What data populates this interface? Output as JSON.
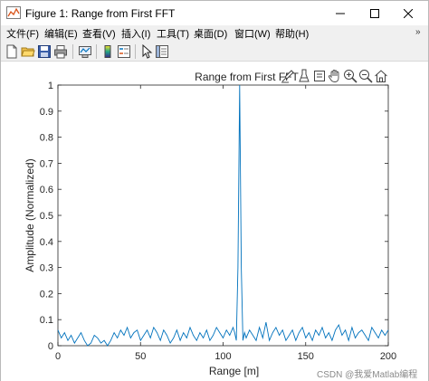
{
  "window": {
    "title": "Figure 1: Range from First FFT",
    "controls": {
      "minimize": "—",
      "maximize": "☐",
      "close": "✕"
    }
  },
  "menu": {
    "items": [
      "文件(F)",
      "编辑(E)",
      "查看(V)",
      "插入(I)",
      "工具(T)",
      "桌面(D)",
      "窗口(W)",
      "帮助(H)"
    ],
    "overflow": "»"
  },
  "toolbar": {
    "buttons": [
      "new-figure-icon",
      "open-icon",
      "save-icon",
      "print-icon",
      "link-plot-icon",
      "colorbar-icon",
      "legend-icon",
      "edit-plot-arrow-icon",
      "property-inspector-icon"
    ]
  },
  "axes_toolbar": {
    "buttons": [
      "brush-icon",
      "data-tips-icon",
      "rotate-icon",
      "pan-hand-icon",
      "zoom-in-icon",
      "zoom-out-icon",
      "home-icon"
    ]
  },
  "watermark": "CSDN @我爱Matlab编程",
  "colors": {
    "line": "#0072bd",
    "axes": "#262626",
    "figure_bg": "#ffffff",
    "window_bg": "#f0f0f0"
  },
  "chart_data": {
    "type": "line",
    "title": "Range from First FFT",
    "xlabel": "Range [m]",
    "ylabel": "Amplitude (Normalized)",
    "xlim": [
      0,
      200
    ],
    "ylim": [
      0,
      1
    ],
    "xticks": [
      0,
      50,
      100,
      150,
      200
    ],
    "yticks": [
      0,
      0.1,
      0.2,
      0.3,
      0.4,
      0.5,
      0.6,
      0.7,
      0.8,
      0.9,
      1
    ],
    "ytick_labels": [
      "0",
      "0.1",
      "0.2",
      "0.3",
      "0.4",
      "0.5",
      "0.6",
      "0.7",
      "0.8",
      "0.9",
      "1"
    ],
    "grid": false,
    "series": [
      {
        "x": [
          0,
          2,
          4,
          6,
          8,
          10,
          12,
          14,
          16,
          18,
          20,
          22,
          24,
          26,
          28,
          30,
          32,
          34,
          36,
          38,
          40,
          42,
          44,
          46,
          48,
          50,
          52,
          54,
          56,
          58,
          60,
          62,
          64,
          66,
          68,
          70,
          72,
          74,
          76,
          78,
          80,
          82,
          84,
          86,
          88,
          90,
          92,
          94,
          96,
          98,
          100,
          102,
          104,
          106,
          107,
          108,
          109,
          110,
          111,
          112,
          113,
          114,
          116,
          118,
          120,
          122,
          124,
          126,
          128,
          130,
          132,
          134,
          136,
          138,
          140,
          142,
          144,
          146,
          148,
          150,
          152,
          154,
          156,
          158,
          160,
          162,
          164,
          166,
          168,
          170,
          172,
          174,
          176,
          178,
          180,
          182,
          184,
          186,
          188,
          190,
          192,
          194,
          196,
          198,
          200
        ],
        "y": [
          0.06,
          0.03,
          0.05,
          0.02,
          0.04,
          0.01,
          0.03,
          0.05,
          0.02,
          0.0,
          0.01,
          0.04,
          0.03,
          0.01,
          0.02,
          0.0,
          0.02,
          0.05,
          0.03,
          0.06,
          0.04,
          0.07,
          0.03,
          0.05,
          0.06,
          0.02,
          0.04,
          0.06,
          0.03,
          0.07,
          0.05,
          0.02,
          0.06,
          0.04,
          0.01,
          0.03,
          0.06,
          0.02,
          0.05,
          0.03,
          0.07,
          0.04,
          0.02,
          0.05,
          0.03,
          0.06,
          0.02,
          0.04,
          0.07,
          0.05,
          0.03,
          0.06,
          0.04,
          0.07,
          0.05,
          0.02,
          0.3,
          1.0,
          0.3,
          0.02,
          0.05,
          0.03,
          0.06,
          0.04,
          0.02,
          0.07,
          0.03,
          0.09,
          0.02,
          0.05,
          0.07,
          0.04,
          0.06,
          0.02,
          0.04,
          0.06,
          0.02,
          0.05,
          0.07,
          0.03,
          0.05,
          0.02,
          0.06,
          0.04,
          0.07,
          0.03,
          0.05,
          0.02,
          0.06,
          0.08,
          0.04,
          0.06,
          0.02,
          0.07,
          0.03,
          0.05,
          0.06,
          0.04,
          0.02,
          0.07,
          0.05,
          0.03,
          0.06,
          0.04,
          0.06
        ]
      }
    ]
  }
}
